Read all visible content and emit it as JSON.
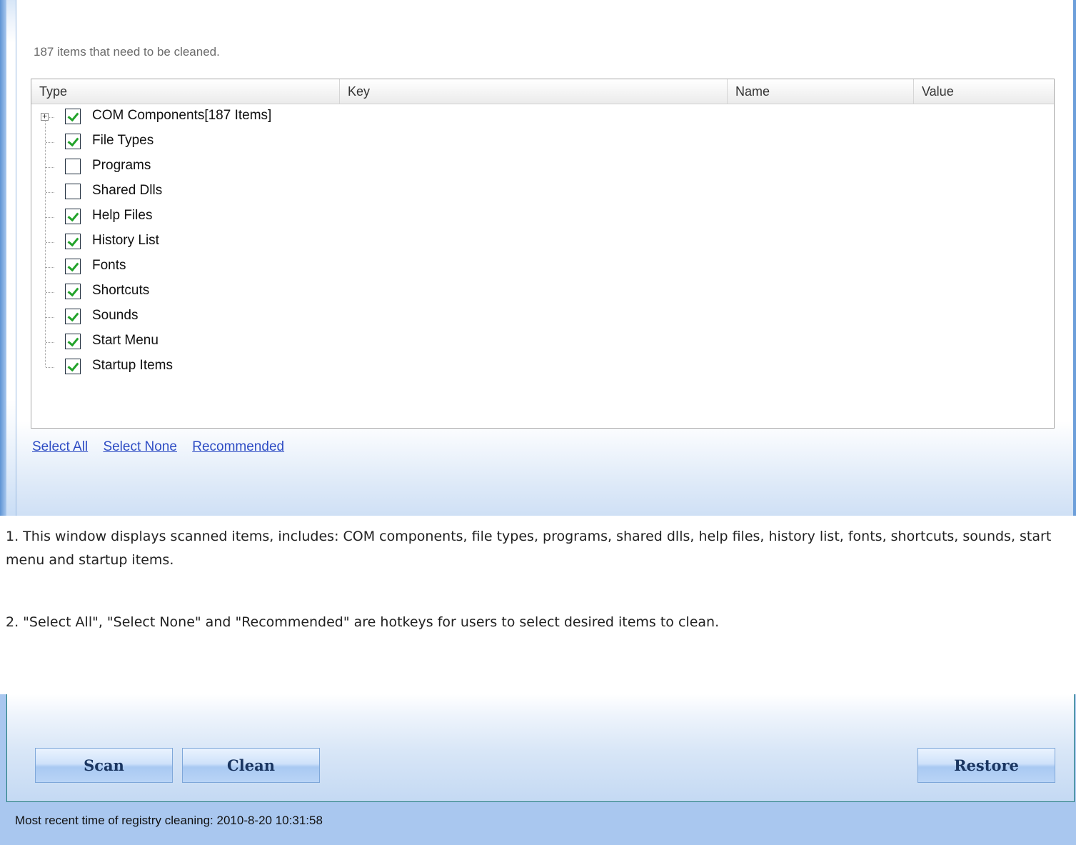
{
  "summary_text": "187 items that need to be cleaned.",
  "columns": [
    "Type",
    "Key",
    "Name",
    "Value"
  ],
  "tree_items": [
    {
      "label": "COM Components[187 Items]",
      "checked": true,
      "expandable": true
    },
    {
      "label": "File Types",
      "checked": true
    },
    {
      "label": "Programs",
      "checked": false
    },
    {
      "label": "Shared Dlls",
      "checked": false
    },
    {
      "label": "Help Files",
      "checked": true
    },
    {
      "label": "History List",
      "checked": true
    },
    {
      "label": "Fonts",
      "checked": true
    },
    {
      "label": "Shortcuts",
      "checked": true
    },
    {
      "label": "Sounds",
      "checked": true
    },
    {
      "label": "Start Menu",
      "checked": true
    },
    {
      "label": "Startup Items",
      "checked": true
    }
  ],
  "links": {
    "select_all": "Select All",
    "select_none": "Select None",
    "recommended": "Recommended"
  },
  "description": {
    "p1": "1. This window displays scanned items, includes: COM components, file types, programs, shared dlls, help files, history list, fonts, shortcuts, sounds, start menu and startup items.",
    "p2": "2. \"Select All\", \"Select None\" and \"Recommended\" are hotkeys for users to select desired items to clean."
  },
  "buttons": {
    "scan": "Scan",
    "clean": "Clean",
    "restore": "Restore"
  },
  "status_text": "Most recent time of registry cleaning: 2010-8-20 10:31:58"
}
